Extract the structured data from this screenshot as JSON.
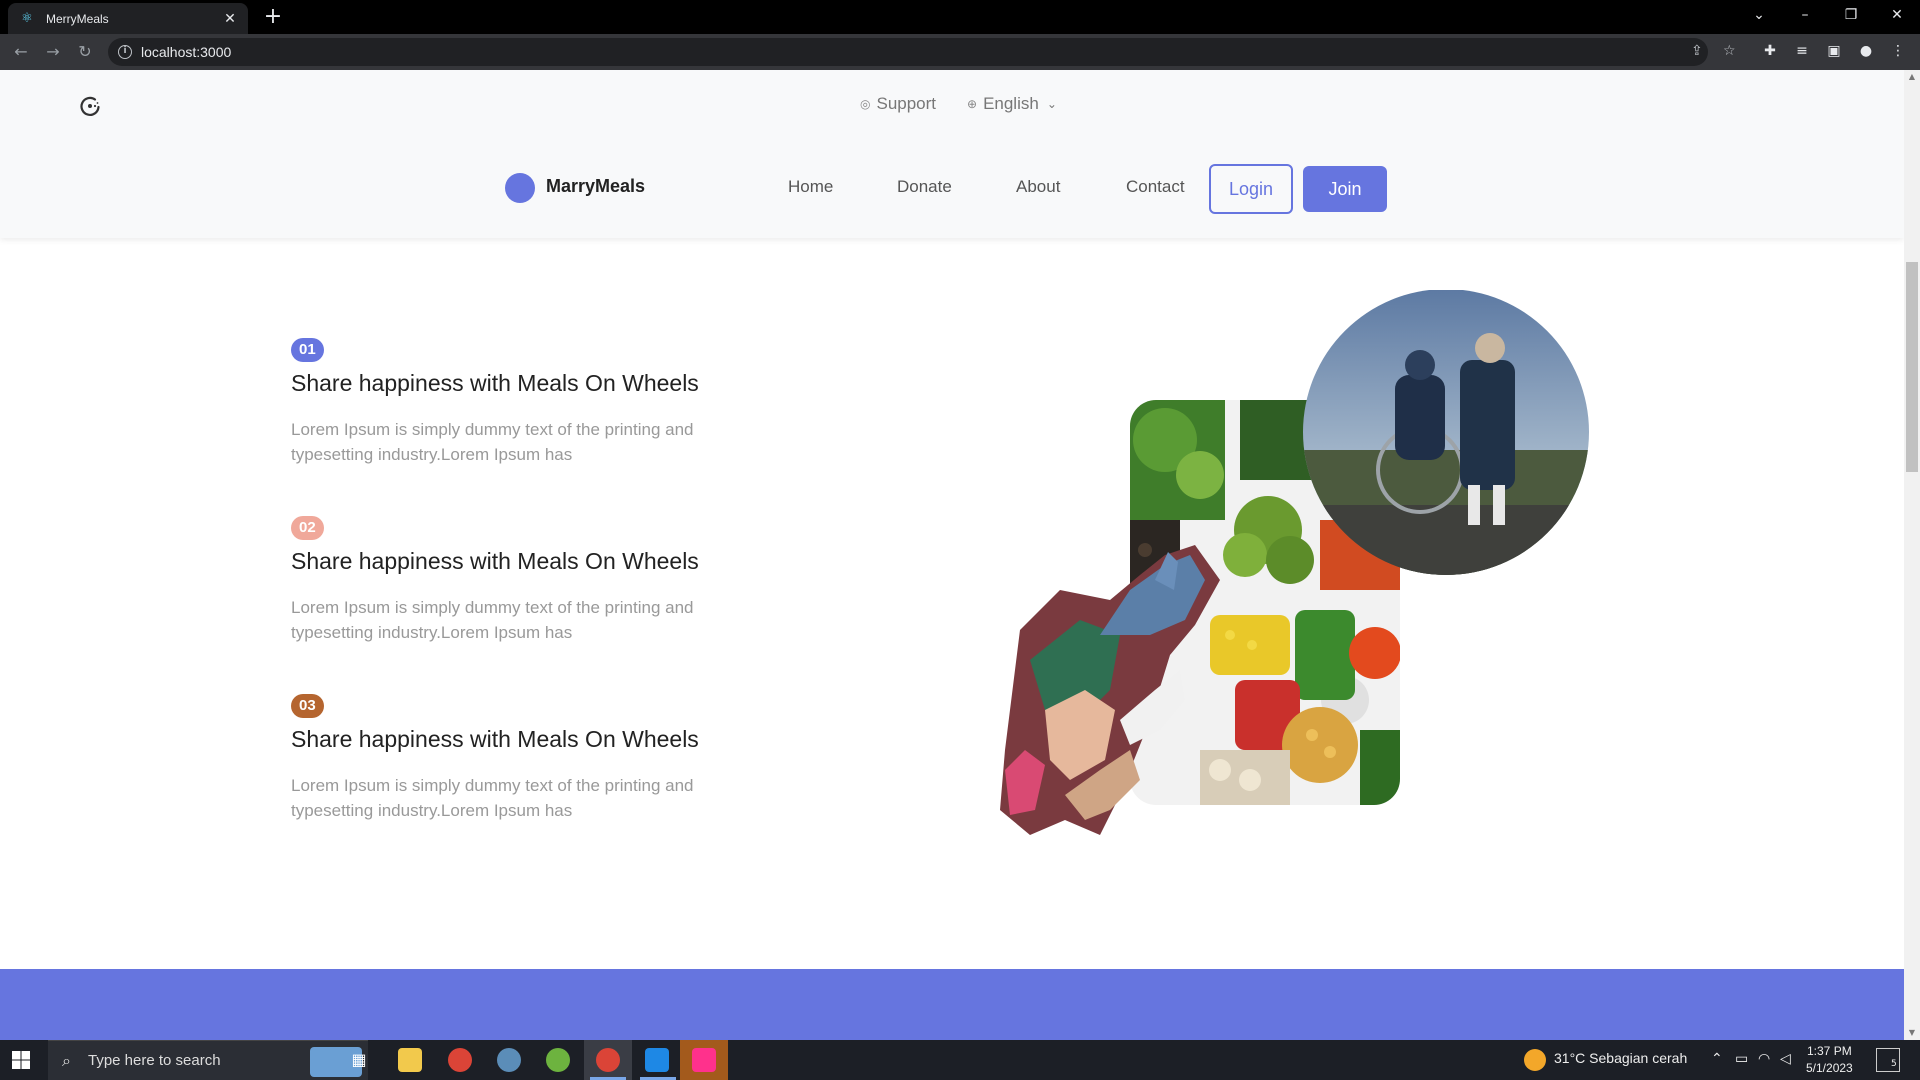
{
  "browser": {
    "tab_title": "MerryMeals",
    "url": "localhost:3000"
  },
  "header": {
    "support_label": "Support",
    "language_label": "English",
    "brand_name": "MarryMeals",
    "nav": {
      "home": "Home",
      "donate": "Donate",
      "about": "About",
      "contact": "Contact"
    },
    "login_label": "Login",
    "join_label": "Join"
  },
  "features": [
    {
      "number": "01",
      "badge_color": "#6675df",
      "title": "Share happiness with Meals On Wheels",
      "description": "Lorem Ipsum is simply dummy text of the printing and typesetting industry.Lorem Ipsum has"
    },
    {
      "number": "02",
      "badge_color": "#f0a89a",
      "title": "Share happiness with Meals On Wheels",
      "description": "Lorem Ipsum is simply dummy text of the printing and typesetting industry.Lorem Ipsum has"
    },
    {
      "number": "03",
      "badge_color": "#b5652f",
      "title": "Share happiness with Meals On Wheels",
      "description": "Lorem Ipsum is simply dummy text of the printing and typesetting industry.Lorem Ipsum has"
    }
  ],
  "colors": {
    "accent": "#6675df"
  },
  "taskbar": {
    "search_placeholder": "Type here to search",
    "weather": "31°C  Sebagian cerah",
    "time": "1:37 PM",
    "date": "5/1/2023",
    "notifications": "5"
  }
}
